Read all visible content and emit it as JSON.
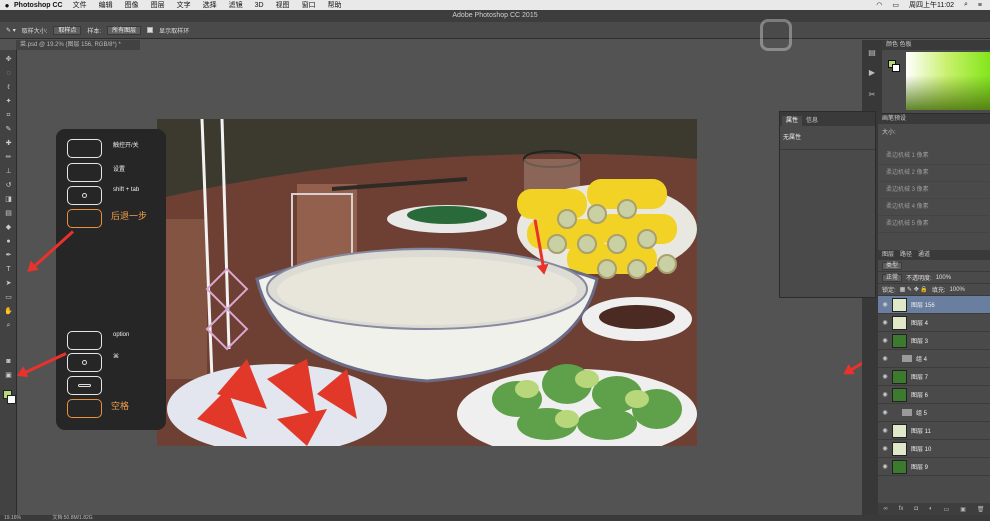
{
  "menubar": {
    "app_name": "Photoshop CC",
    "items": [
      "文件",
      "编辑",
      "图像",
      "图层",
      "文字",
      "选择",
      "滤镜",
      "3D",
      "视图",
      "窗口",
      "帮助"
    ],
    "clock": "周四上午11:02"
  },
  "window_title": "Adobe Photoshop CC 2015",
  "options_bar": {
    "sample_size_label": "取样大小:",
    "sample_size_value": "取样点",
    "sample_label": "样本:",
    "sample_value": "所有图层",
    "show_ring_label": "显示取样环"
  },
  "document_tab": "菜.psd @ 19.2% (图层 156, RGB/8*) *",
  "shortcut_overlay": {
    "items": [
      {
        "label": "触控开/关"
      },
      {
        "label": "设置"
      },
      {
        "label": "shift + tab"
      },
      {
        "label": "后退一步"
      },
      {
        "label": "option"
      },
      {
        "label": "⌘"
      },
      {
        "label": ""
      },
      {
        "label": "空格"
      }
    ]
  },
  "properties_panel": {
    "tabs": [
      "属性",
      "信息"
    ],
    "body": "无属性"
  },
  "brush_panel": {
    "title": "画笔预设",
    "size_label": "大小:",
    "presets": [
      "柔边机械 1 像素",
      "柔边机械 2 像素",
      "柔边机械 3 像素",
      "柔边机械 4 像素",
      "柔边机械 5 像素"
    ]
  },
  "layers_panel": {
    "tabs": [
      "图层",
      "路径",
      "通道"
    ],
    "filter_label": "类型",
    "blend_mode": "正常",
    "opacity_label": "不透明度:",
    "opacity_value": "100%",
    "lock_label": "锁定:",
    "fill_label": "填充:",
    "fill_value": "100%",
    "layers": [
      {
        "name": "图层 156",
        "type": "layer",
        "selected": true,
        "thumb": "light"
      },
      {
        "name": "图层 4",
        "type": "layer",
        "selected": false,
        "thumb": "light"
      },
      {
        "name": "图层 3",
        "type": "layer",
        "selected": false,
        "thumb": "dark"
      },
      {
        "name": "组 4",
        "type": "group",
        "selected": false
      },
      {
        "name": "图层 7",
        "type": "layer",
        "selected": false,
        "thumb": "dark"
      },
      {
        "name": "图层 6",
        "type": "layer",
        "selected": false,
        "thumb": "dark"
      },
      {
        "name": "组 5",
        "type": "group",
        "selected": false
      },
      {
        "name": "图层 11",
        "type": "layer",
        "selected": false,
        "thumb": "light"
      },
      {
        "name": "图层 10",
        "type": "layer",
        "selected": false,
        "thumb": "light"
      },
      {
        "name": "图层 9",
        "type": "layer",
        "selected": false,
        "thumb": "dark"
      }
    ]
  },
  "statusbar": {
    "zoom": "19.16%",
    "doc_info": "文档:50.8M/1.82G"
  },
  "colors": {
    "foreground": "#b8d67a",
    "background": "#ffffff",
    "arrow": "#e8322b"
  }
}
